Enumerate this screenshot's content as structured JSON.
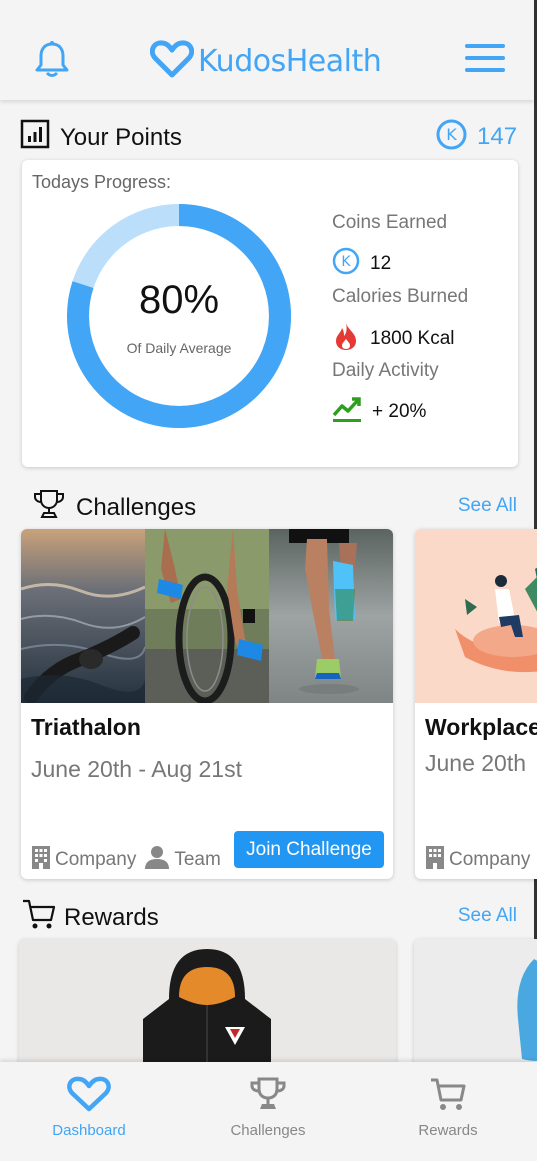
{
  "header": {
    "brand": "KudosHealth",
    "icons": {
      "left": "bell-icon",
      "right": "hamburger-menu-icon",
      "logo": "heart-logo-icon"
    }
  },
  "points": {
    "title": "Your Points",
    "value": "147",
    "coin_letter": "K"
  },
  "progress": {
    "label": "Todays Progress:",
    "percent_text": "80%",
    "percent_value": 0.8,
    "subtitle": "Of Daily Average",
    "coins_label": "Coins Earned",
    "coins_value": "12",
    "calories_label": "Calories Burned",
    "calories_value": "1800 Kcal",
    "activity_label": "Daily Activity",
    "activity_value": "+ 20%"
  },
  "challenges": {
    "title": "Challenges",
    "see_all": "See All",
    "items": [
      {
        "name": "Triathalon",
        "dates": "June 20th - Aug 21st",
        "company": "Company",
        "team": "Team",
        "join": "Join Challenge"
      },
      {
        "name": "Workplace",
        "dates": "June 20th",
        "company": "Company"
      }
    ]
  },
  "rewards": {
    "title": "Rewards",
    "see_all": "See All"
  },
  "nav": {
    "items": [
      {
        "label": "Dashboard",
        "icon": "heart-icon"
      },
      {
        "label": "Challenges",
        "icon": "trophy-icon"
      },
      {
        "label": "Rewards",
        "icon": "cart-icon"
      }
    ]
  },
  "colors": {
    "accent": "#42a5f5",
    "button": "#2196f3",
    "ring_light": "#bbdefb",
    "fire": "#e53935",
    "trend": "#2e9e1f"
  }
}
